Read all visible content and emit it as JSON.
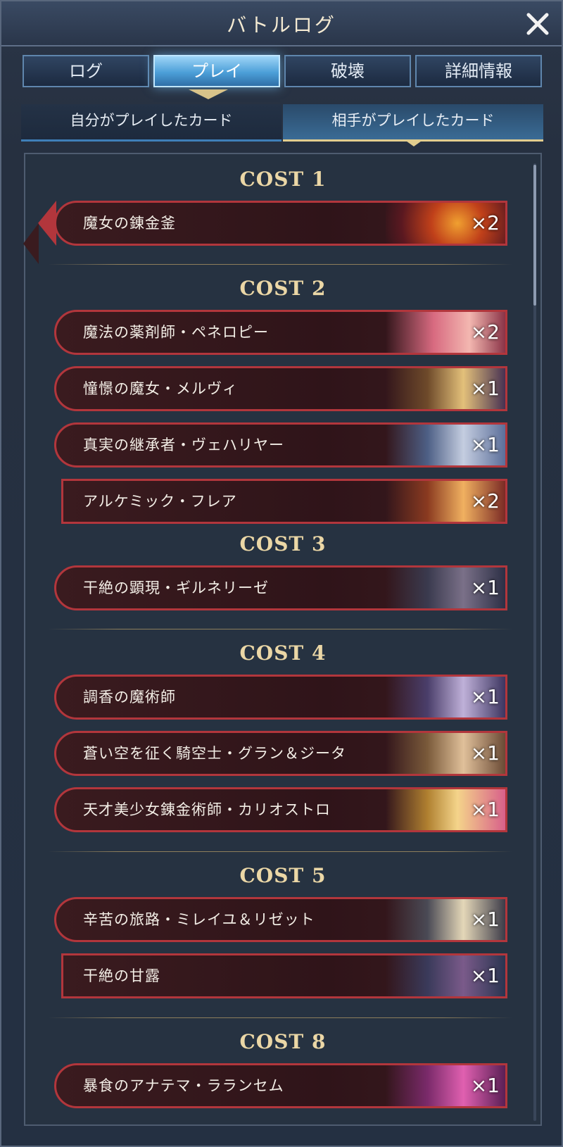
{
  "header": {
    "title": "バトルログ"
  },
  "tabs": [
    {
      "label": "ログ",
      "active": false
    },
    {
      "label": "プレイ",
      "active": true
    },
    {
      "label": "破壊",
      "active": false
    },
    {
      "label": "詳細情報",
      "active": false
    }
  ],
  "subtabs": [
    {
      "label": "自分がプレイしたカード",
      "active": false
    },
    {
      "label": "相手がプレイしたカード",
      "active": true
    }
  ],
  "cost_groups": [
    {
      "header": "COST 1",
      "cards": [
        {
          "name": "魔女の錬金釜",
          "count": "×2",
          "kind": "spell"
        }
      ]
    },
    {
      "header": "COST 2",
      "cards": [
        {
          "name": "魔法の薬剤師・ペネロピー",
          "count": "×2",
          "kind": "follower"
        },
        {
          "name": "憧憬の魔女・メルヴィ",
          "count": "×1",
          "kind": "follower"
        },
        {
          "name": "真実の継承者・ヴェハリヤー",
          "count": "×1",
          "kind": "follower"
        },
        {
          "name": "アルケミック・フレア",
          "count": "×2",
          "kind": "amulet"
        }
      ]
    },
    {
      "header": "COST 3",
      "cards": [
        {
          "name": "干絶の顕現・ギルネリーゼ",
          "count": "×1",
          "kind": "follower"
        }
      ]
    },
    {
      "header": "COST 4",
      "cards": [
        {
          "name": "調香の魔術師",
          "count": "×1",
          "kind": "follower"
        },
        {
          "name": "蒼い空を征く騎空士・グラン＆ジータ",
          "count": "×1",
          "kind": "follower"
        },
        {
          "name": "天才美少女錬金術師・カリオストロ",
          "count": "×1",
          "kind": "follower"
        }
      ]
    },
    {
      "header": "COST 5",
      "cards": [
        {
          "name": "辛苦の旅路・ミレイユ＆リゼット",
          "count": "×1",
          "kind": "follower"
        },
        {
          "name": "干絶の甘露",
          "count": "×1",
          "kind": "amulet"
        }
      ]
    },
    {
      "header": "COST 8",
      "cards": [
        {
          "name": "暴食のアナテマ・ラランセム",
          "count": "×1",
          "kind": "follower"
        }
      ]
    }
  ],
  "colors": {
    "card_border": "#b2363c",
    "cost_header": "#ebd7a6",
    "active_tab": "#4c9fd8"
  },
  "icons": {
    "close": "close-icon"
  }
}
